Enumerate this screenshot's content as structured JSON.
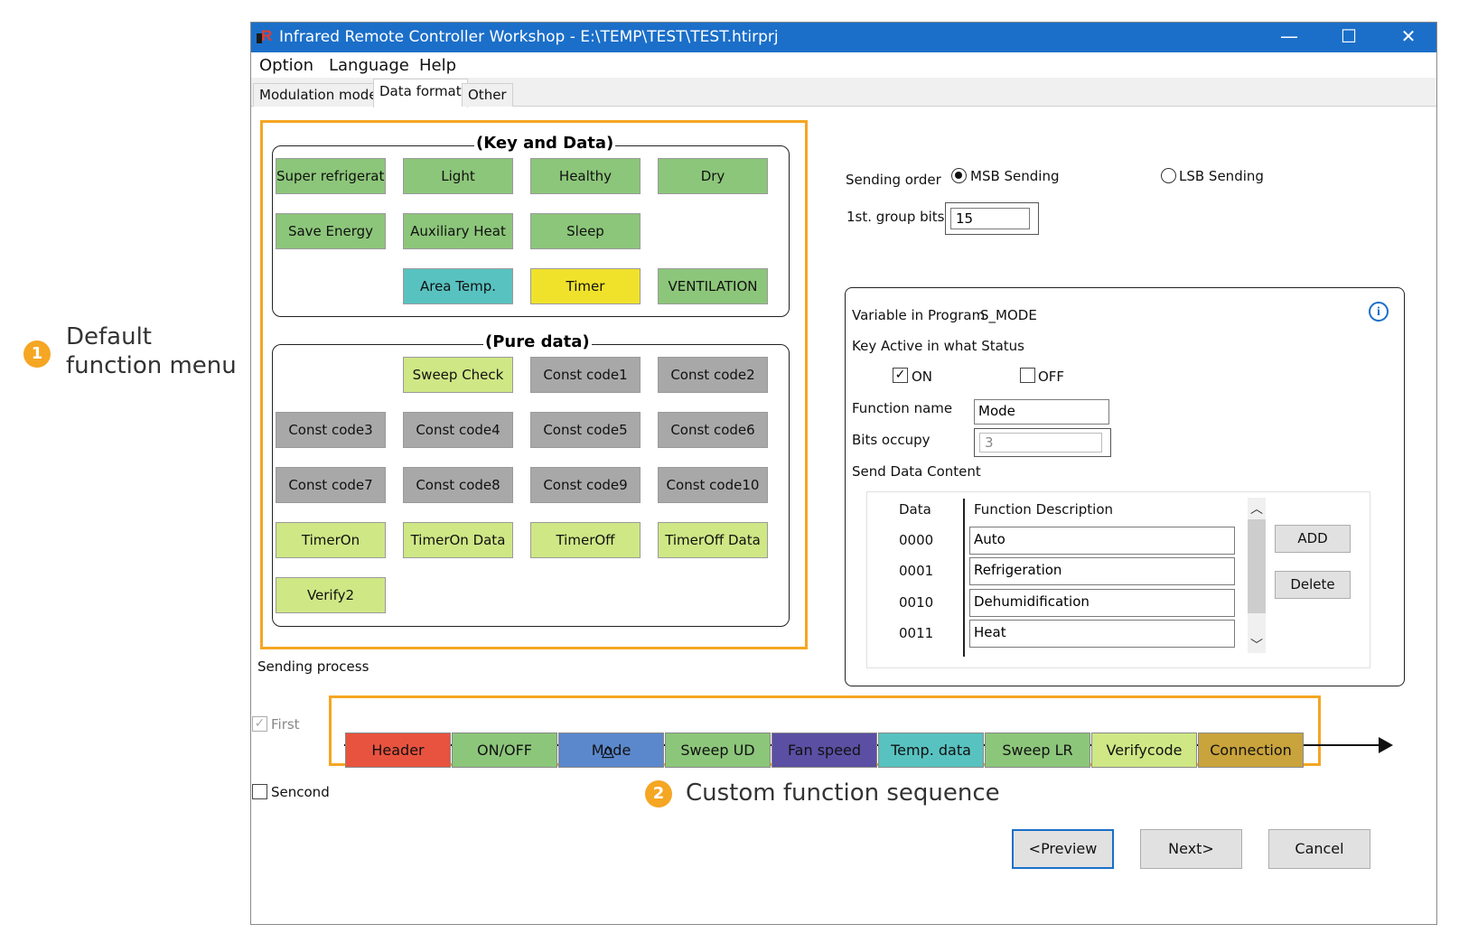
{
  "annotations": {
    "callout1": {
      "number": "1",
      "line1": "Default",
      "line2": "function menu"
    },
    "callout2": {
      "number": "2",
      "text": "Custom function sequence"
    }
  },
  "window": {
    "title": "Infrared Remote Controller Workshop - E:\\TEMP\\TEST\\TEST.htirprj",
    "controls": {
      "minimize": "—",
      "maximize": "☐",
      "close": "✕"
    }
  },
  "menu": [
    "Option",
    "Language",
    "Help"
  ],
  "tabs": [
    "Modulation mode",
    "Data format",
    "Other"
  ],
  "key_and_data": {
    "title": "(Key and Data)",
    "buttons": [
      {
        "label": "Super refrigerate",
        "color": "#8cc67a"
      },
      {
        "label": "Light",
        "color": "#8cc67a"
      },
      {
        "label": "Healthy",
        "color": "#8cc67a"
      },
      {
        "label": "Dry",
        "color": "#8cc67a"
      },
      {
        "label": "Save Energy",
        "color": "#8cc67a"
      },
      {
        "label": "Auxiliary Heat",
        "color": "#8cc67a"
      },
      {
        "label": "Sleep",
        "color": "#8cc67a"
      },
      {
        "label": "Area Temp.",
        "color": "#58c2c0"
      },
      {
        "label": "Timer",
        "color": "#f0e22b"
      },
      {
        "label": "VENTILATION",
        "color": "#8cc67a"
      }
    ]
  },
  "pure_data": {
    "title": "(Pure data)",
    "buttons": [
      {
        "label": "Sweep Check",
        "color": "#cfe785"
      },
      {
        "label": "Const code1",
        "color": "#a8a8a8"
      },
      {
        "label": "Const code2",
        "color": "#a8a8a8"
      },
      {
        "label": "Const code3",
        "color": "#a8a8a8"
      },
      {
        "label": "Const code4",
        "color": "#a8a8a8"
      },
      {
        "label": "Const code5",
        "color": "#a8a8a8"
      },
      {
        "label": "Const code6",
        "color": "#a8a8a8"
      },
      {
        "label": "Const code7",
        "color": "#a8a8a8"
      },
      {
        "label": "Const code8",
        "color": "#a8a8a8"
      },
      {
        "label": "Const code9",
        "color": "#a8a8a8"
      },
      {
        "label": "Const code10",
        "color": "#a8a8a8"
      },
      {
        "label": "TimerOn",
        "color": "#cfe785"
      },
      {
        "label": "TimerOn Data",
        "color": "#cfe785"
      },
      {
        "label": "TimerOff",
        "color": "#cfe785"
      },
      {
        "label": "TimerOff Data",
        "color": "#cfe785"
      },
      {
        "label": "Verify2",
        "color": "#cfe785"
      }
    ]
  },
  "sending": {
    "order_label": "Sending order",
    "msb_label": "MSB Sending",
    "lsb_label": "LSB Sending",
    "selected": "MSB Sending",
    "group_bits_label": "1st. group bits",
    "group_bits_value": "15"
  },
  "variable_panel": {
    "variable_label": "Variable in Program",
    "variable_value": "S_MODE",
    "info_icon": "i",
    "status_label": "Key Active in what Status",
    "on_label": "ON",
    "off_label": "OFF",
    "on_checked": true,
    "off_checked": false,
    "function_name_label": "Function name",
    "function_name_value": "Mode",
    "bits_label": "Bits occupy",
    "bits_value": "3",
    "send_content_label": "Send Data Content",
    "table_headers": [
      "Data",
      "Function Description"
    ],
    "rows": [
      {
        "data": "0000",
        "desc": "Auto"
      },
      {
        "data": "0001",
        "desc": "Refrigeration"
      },
      {
        "data": "0010",
        "desc": "Dehumidification"
      },
      {
        "data": "0011",
        "desc": "Heat"
      }
    ],
    "add_label": "ADD",
    "delete_label": "Delete"
  },
  "process": {
    "label": "Sending process",
    "first_label": "First",
    "second_label": "Sencond",
    "sequence": [
      {
        "label": "Header",
        "color": "#e8533f"
      },
      {
        "label": "ON/OFF",
        "color": "#8cc67a"
      },
      {
        "label": "Mode",
        "color": "#5b87cc"
      },
      {
        "label": "Sweep UD",
        "color": "#8cc67a"
      },
      {
        "label": "Fan speed",
        "color": "#5a4fa3"
      },
      {
        "label": "Temp. data",
        "color": "#58c2c0"
      },
      {
        "label": "Sweep LR",
        "color": "#8cc67a"
      },
      {
        "label": "Verifycode",
        "color": "#cfe785"
      },
      {
        "label": "Connection",
        "color": "#c9a33b"
      }
    ],
    "selected_marker": "△"
  },
  "footer": {
    "preview": "<Preview",
    "next": "Next>",
    "cancel": "Cancel"
  }
}
